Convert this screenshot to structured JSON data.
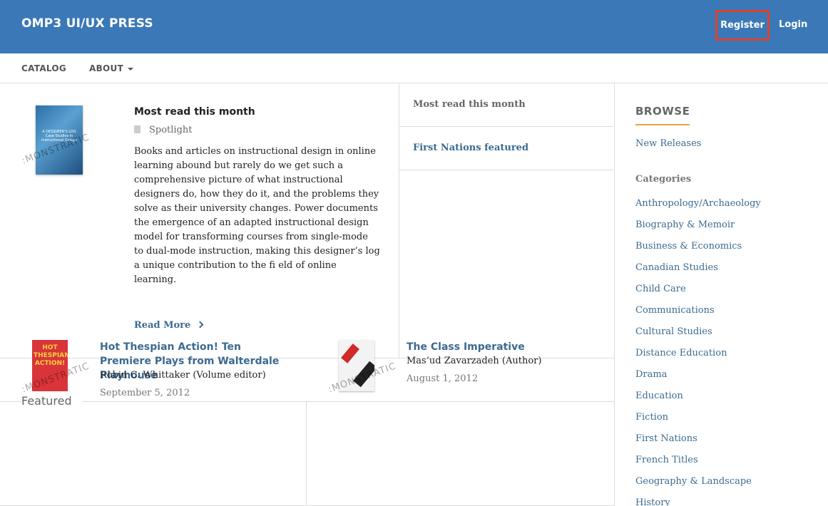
{
  "header": {
    "site_title": "OMP3 UI/UX PRESS",
    "register_label": "Register",
    "login_label": "Login",
    "brand_color": "#3b78b8",
    "highlight_color": "#e0412e"
  },
  "nav": {
    "catalog": "CATALOG",
    "about": "ABOUT"
  },
  "spotlight": {
    "title": "Most read this month",
    "type": "Spotlight",
    "cover_text": "A DESIGNER'S LOG Case Studies in Instructional Design",
    "watermark": ":MONSTRATIC",
    "description": "Books and articles on instructional design in online learning abound but rarely do we get such a comprehensive picture of what instructional designers do, how they do it, and the problems they solve as their university changes. Power documents the emergence of an adapted instructional design model for transforming courses from single-mode to dual-mode instruction, making this designer’s log a unique contribution to the fi eld of online learning.",
    "read_more": "Read More"
  },
  "tabs": [
    {
      "label": "Most read this month"
    },
    {
      "label": "First Nations featured"
    }
  ],
  "featured": {
    "label": "Featured",
    "items": [
      {
        "title": "Hot Thespian Action! Ten Premiere Plays from Walterdale Playhouse",
        "cover_text": "HOT THESPIAN ACTION!",
        "author": "Robin C. Whittaker (Volume editor)",
        "date": "September 5, 2012"
      },
      {
        "title": "The Class Imperative",
        "author": "Mas’ud Zavarzadeh (Author)",
        "date": "August 1, 2012"
      }
    ]
  },
  "sidebar": {
    "browse_title": "BROWSE",
    "new_releases": "New Releases",
    "categories_heading": "Categories",
    "categories": [
      "Anthropology/Archaeology",
      "Biography & Memoir",
      "Business & Economics",
      "Canadian Studies",
      "Child Care",
      "Communications",
      "Cultural Studies",
      "Distance Education",
      "Drama",
      "Education",
      "Fiction",
      "First Nations",
      "French Titles",
      "Geography & Landscape",
      "History"
    ]
  }
}
